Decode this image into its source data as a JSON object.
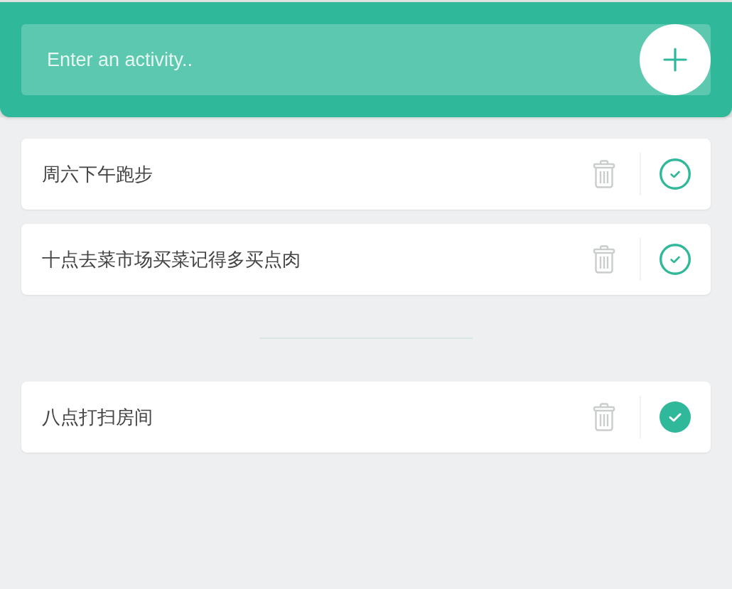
{
  "header": {
    "activity_input": {
      "placeholder": "Enter an activity.."
    }
  },
  "todo_list": {
    "items": [
      {
        "text": "周六下午跑步",
        "checked": false
      },
      {
        "text": "十点去菜市场买菜记得多买点肉",
        "checked": false
      }
    ]
  },
  "completed_list": {
    "items": [
      {
        "text": "八点打扫房间",
        "checked": true
      }
    ]
  }
}
